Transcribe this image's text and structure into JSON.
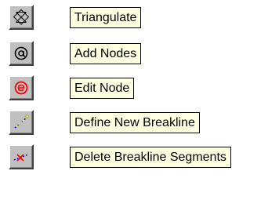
{
  "toolbar": {
    "tools": [
      {
        "icon": "triangulate-icon",
        "label": "Triangulate"
      },
      {
        "icon": "add-nodes-icon",
        "label": "Add Nodes"
      },
      {
        "icon": "edit-node-icon",
        "label": "Edit Node"
      },
      {
        "icon": "define-breakline-icon",
        "label": "Define New Breakline"
      },
      {
        "icon": "delete-breakline-segments-icon",
        "label": "Delete Breakline Segments"
      }
    ]
  },
  "colors": {
    "button_face": "#c0c0c0",
    "tooltip_background": "#ffffe1",
    "edit_icon_red": "#ff0000",
    "breakline_blue": "#0000ff",
    "breakline_yellow": "#ffff00",
    "delete_red": "#ff0000"
  }
}
